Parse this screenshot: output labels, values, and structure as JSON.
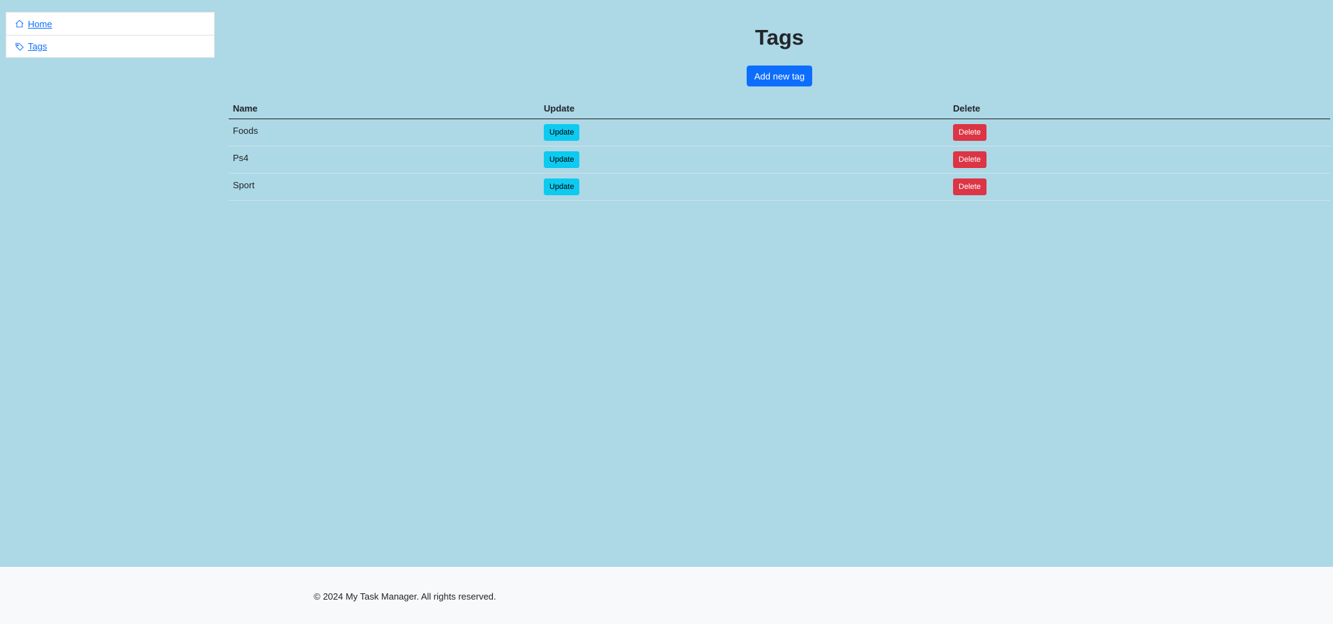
{
  "sidebar": {
    "items": [
      {
        "label": "Home",
        "icon": "home-icon"
      },
      {
        "label": "Tags",
        "icon": "tag-icon"
      }
    ]
  },
  "main": {
    "title": "Tags",
    "add_button": "Add new tag",
    "table": {
      "headers": [
        "Name",
        "Update",
        "Delete"
      ],
      "rows": [
        {
          "name": "Foods",
          "update": "Update",
          "delete": "Delete"
        },
        {
          "name": "Ps4",
          "update": "Update",
          "delete": "Delete"
        },
        {
          "name": "Sport",
          "update": "Update",
          "delete": "Delete"
        }
      ]
    }
  },
  "footer": {
    "text": "© 2024 My Task Manager. All rights reserved."
  },
  "colors": {
    "background": "#add8e6",
    "primary": "#0d6efd",
    "info": "#0dcaf0",
    "danger": "#dc3545",
    "footer": "#f8f9fa"
  }
}
